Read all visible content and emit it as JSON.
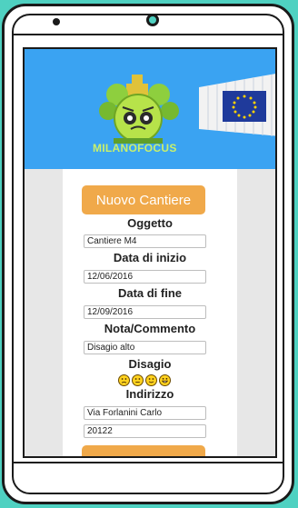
{
  "banner": {
    "logo_text": "MILANOFOCUS",
    "colors": {
      "background": "#3aa3f2",
      "eu_flag": "#1f3a9b"
    }
  },
  "form": {
    "new_button_label": "Nuovo Cantiere",
    "oggetto_label": "Oggetto",
    "oggetto_value": "Cantiere M4",
    "data_inizio_label": "Data di inizio",
    "data_inizio_value": "12/06/2016",
    "data_fine_label": "Data di fine",
    "data_fine_value": "12/09/2016",
    "nota_label": "Nota/Commento",
    "nota_value": "Disagio alto",
    "disagio_label": "Disagio",
    "disagio_icons": [
      "sad-face-icon",
      "neutral-face-icon",
      "smile-face-icon",
      "grin-face-icon"
    ],
    "indirizzo_label": "Indirizzo",
    "indirizzo_value": "Via Forlanini Carlo",
    "cap_value": "20122"
  },
  "colors": {
    "accent": "#f0a94a",
    "phone_background": "#4fd1c1"
  }
}
